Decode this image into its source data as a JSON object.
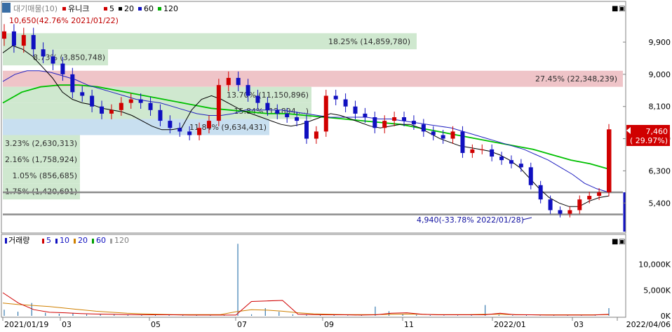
{
  "price_panel": {
    "legend": {
      "title": "대기매물(10)",
      "stock_name": "유니크",
      "ma_labels": [
        {
          "label": "5",
          "color": "#d00000"
        },
        {
          "label": "20",
          "color": "#000000"
        },
        {
          "label": "60",
          "color": "#1010c0"
        },
        {
          "label": "120",
          "color": "#00b000"
        }
      ]
    },
    "high_marker": "10,650(42.76% 2021/01/22)",
    "low_marker": "4,940(-33.78% 2022/01/28)",
    "current_price": "7,460",
    "current_change": "( 29.97%)",
    "y_axis_ticks": [
      "9,900",
      "9,000",
      "8,100",
      "7,200",
      "6,300",
      "5,400"
    ],
    "ylim": [
      4600,
      11000
    ],
    "tool_icons": [
      "■",
      "▣"
    ]
  },
  "volume_panel": {
    "legend": {
      "title": "거래량",
      "ma_labels": [
        {
          "label": "5",
          "color": "#d00000"
        },
        {
          "label": "10",
          "color": "#1010c0"
        },
        {
          "label": "20",
          "color": "#d08000"
        },
        {
          "label": "60",
          "color": "#00a000"
        },
        {
          "label": "120",
          "color": "#a0a0a0"
        }
      ]
    },
    "y_axis_ticks": [
      "10,000K",
      "5,000K",
      "0K"
    ],
    "ylim": [
      0,
      15000
    ],
    "tool_icons": [
      "■",
      "▣"
    ]
  },
  "x_axis_labels": [
    "2021/01/19",
    "03",
    "05",
    "07",
    "09",
    "11",
    "2022/01",
    "03",
    "2022/04/06"
  ],
  "chart_data": {
    "type": "candlestick",
    "supply_zones": [
      {
        "label": "18.25% (14,859,780)",
        "from": 9700,
        "to": 10150,
        "color": "#cfe8cf"
      },
      {
        "label": "8.73% (3,850,748)",
        "from": 9250,
        "to": 9700,
        "color": "#cfe8cf"
      },
      {
        "label": "27.45% (22,348,239)",
        "from": 8650,
        "to": 9100,
        "color": "#efc4c8"
      },
      {
        "label": "13.70% (11,150,896)",
        "from": 8200,
        "to": 8650,
        "color": "#cfe8cf"
      },
      {
        "label": "15.84% (12,894,...)",
        "from": 7750,
        "to": 8200,
        "color": "#cfe8cf"
      },
      {
        "label": "11.84% (9,634,431)",
        "from": 7300,
        "to": 7750,
        "color": "#c8dff0"
      },
      {
        "label": "3.23% (2,630,313)",
        "from": 6850,
        "to": 7300,
        "color": "#cfe8cf"
      },
      {
        "label": "2.16% (1,758,924)",
        "from": 6400,
        "to": 6850,
        "color": "#cfe8cf"
      },
      {
        "label": "1.05% (856,685)",
        "from": 5950,
        "to": 6400,
        "color": "#cfe8cf"
      },
      {
        "label": "1.75% (1,420,691)",
        "from": 5500,
        "to": 5950,
        "color": "#cfe8cf"
      }
    ],
    "horizontal_lines": [
      5700,
      5080
    ],
    "closes_weekly": [
      10200,
      9800,
      10100,
      9700,
      9500,
      9300,
      9000,
      8500,
      8400,
      8100,
      7900,
      8000,
      8200,
      8300,
      8200,
      8000,
      7700,
      7500,
      7400,
      7300,
      7500,
      7700,
      8700,
      8900,
      8700,
      8400,
      8200,
      8000,
      7900,
      7800,
      7700,
      7200,
      7400,
      8400,
      8300,
      8100,
      7900,
      7800,
      7500,
      7700,
      7800,
      7700,
      7600,
      7400,
      7300,
      7200,
      7400,
      6800,
      6900,
      6900,
      6700,
      6600,
      6500,
      6400,
      5900,
      5500,
      5200,
      5100,
      5200,
      5500,
      5600,
      5700,
      7460
    ],
    "ma20": [
      9600,
      9800,
      9700,
      9500,
      9200,
      8900,
      8500,
      8300,
      8200,
      8150,
      8050,
      8000,
      7950,
      7850,
      7700,
      7550,
      7450,
      7450,
      7500,
      8000,
      8300,
      8400,
      8300,
      8150,
      8000,
      7900,
      7800,
      7700,
      7600,
      7550,
      7600,
      7700,
      7800,
      7900,
      7850,
      7750,
      7650,
      7550,
      7500,
      7550,
      7600,
      7600,
      7500,
      7350,
      7200,
      7100,
      7000,
      6950,
      6900,
      6850,
      6750,
      6600,
      6400,
      6100,
      5800,
      5550,
      5400,
      5300,
      5300,
      5450,
      5550,
      5600
    ],
    "ma60": [
      8800,
      9000,
      9100,
      9100,
      9050,
      8950,
      8850,
      8700,
      8600,
      8500,
      8400,
      8300,
      8250,
      8200,
      8100,
      8000,
      7900,
      7850,
      7850,
      7900,
      8000,
      8000,
      8000,
      8000,
      7950,
      7900,
      7850,
      7800,
      7800,
      7800,
      7800,
      7750,
      7750,
      7700,
      7650,
      7600,
      7550,
      7500,
      7400,
      7300,
      7200,
      7100,
      7000,
      6900,
      6750,
      6600,
      6400,
      6200,
      5950,
      5800,
      5700
    ],
    "ma120": [
      8200,
      8500,
      8650,
      8700,
      8700,
      8650,
      8550,
      8450,
      8350,
      8250,
      8150,
      8050,
      8000,
      7950,
      7900,
      7900,
      7850,
      7800,
      7750,
      7700,
      7650,
      7600,
      7500,
      7400,
      7300,
      7200,
      7100,
      7000,
      6900,
      6750,
      6600,
      6500,
      6350
    ],
    "volume_bars": [
      1200,
      800,
      2500,
      600,
      400,
      500,
      300,
      400,
      300,
      250,
      200,
      200,
      150,
      150,
      200,
      150,
      150,
      14000,
      300,
      1500,
      800,
      300,
      200,
      200,
      150,
      100,
      200,
      1800,
      900,
      300,
      200,
      150,
      100,
      100,
      300,
      2100,
      200,
      150,
      150,
      100,
      100,
      100,
      100,
      100,
      1500
    ],
    "volume_ma5": [
      4500,
      2500,
      1200,
      700,
      600,
      450,
      350,
      300,
      250,
      200,
      200,
      200,
      150,
      150,
      150,
      150,
      2800,
      2900,
      3000,
      300,
      250,
      200,
      200,
      150,
      200,
      500,
      600,
      300,
      200,
      200,
      200,
      200,
      500,
      200,
      200,
      150,
      150,
      150,
      150,
      300
    ],
    "volume_ma20": [
      2500,
      2200,
      2000,
      1800,
      1500,
      1200,
      900,
      700,
      500,
      400,
      300,
      250,
      250,
      250,
      250,
      800,
      1200,
      1100,
      900,
      600,
      400,
      300,
      250,
      250,
      250,
      300,
      350,
      300,
      250,
      250,
      250,
      300,
      300,
      250,
      200,
      200,
      200,
      200,
      200,
      250
    ]
  }
}
